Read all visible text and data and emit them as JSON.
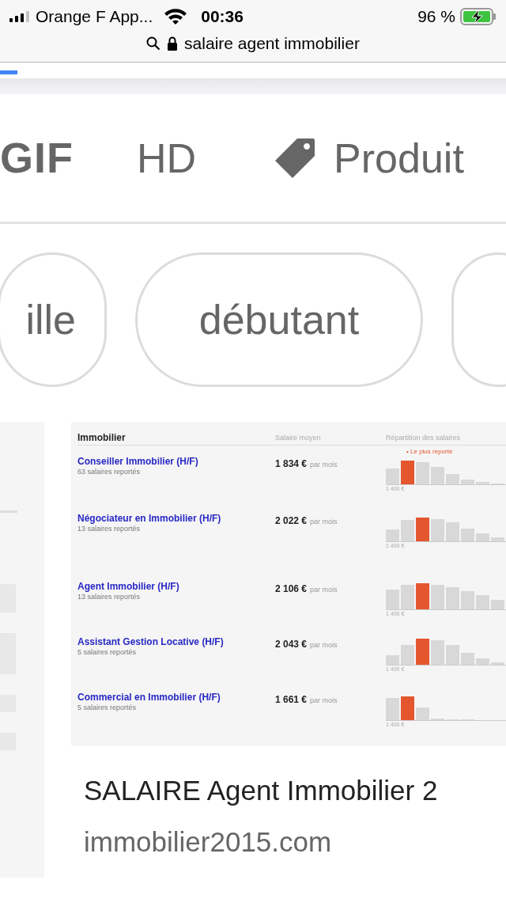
{
  "status_bar": {
    "carrier": "Orange F App...",
    "time": "00:36",
    "battery": "96 %"
  },
  "address_bar": {
    "query": "salaire agent immobilier"
  },
  "loading_bar": {
    "level": 0.035
  },
  "filters": [
    {
      "label": "GIF",
      "kind": "logo"
    },
    {
      "label": "HD",
      "kind": "plain"
    },
    {
      "label": "Produit",
      "kind": "tag"
    }
  ],
  "chips": [
    {
      "label": "ille"
    },
    {
      "label": "débutant"
    }
  ],
  "result": {
    "image": {
      "heading": "Immobilier",
      "column_salary": "Salaire moyen",
      "column_distribution": "Répartition des salaires",
      "rows": [
        {
          "title": "Conseiller Immobilier (H/F)",
          "reports": "63 salaires reportés",
          "salary": "1 834 €",
          "unit": "par mois",
          "note": "• Le plus reporté",
          "axis": "1 400 €"
        },
        {
          "title": "Négociateur en Immobilier (H/F)",
          "reports": "13 salaires reportés",
          "salary": "2 022 €",
          "unit": "par mois",
          "axis": "1 400 €"
        },
        {
          "title": "Agent Immobilier (H/F)",
          "reports": "13 salaires reportés",
          "salary": "2 106 €",
          "unit": "par mois",
          "axis": "1 400 €"
        },
        {
          "title": "Assistant Gestion Locative (H/F)",
          "reports": "5 salaires reportés",
          "salary": "2 043 €",
          "unit": "par mois",
          "axis": "1 400 €"
        },
        {
          "title": "Commercial en Immobilier (H/F)",
          "reports": "5 salaires reportés",
          "salary": "1 661 €",
          "unit": "par mois",
          "axis": "1 400 €"
        }
      ]
    },
    "title": "SALAIRE Agent Immobilier 2",
    "source": "immobilier2015.com"
  }
}
